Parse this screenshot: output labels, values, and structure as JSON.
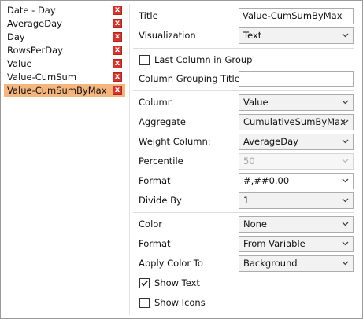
{
  "columns": [
    {
      "label": "Date - Day"
    },
    {
      "label": "AverageDay"
    },
    {
      "label": "Day"
    },
    {
      "label": "RowsPerDay"
    },
    {
      "label": "Value"
    },
    {
      "label": "Value-CumSum"
    },
    {
      "label": "Value-CumSumByMax",
      "selected": true
    }
  ],
  "delete_glyph": "x",
  "props": {
    "title_label": "Title",
    "title_value": "Value-CumSumByMax",
    "visualization_label": "Visualization",
    "visualization_value": "Text",
    "last_column_label": "Last Column in Group",
    "last_column_checked": false,
    "grouping_title_label": "Column Grouping Title",
    "grouping_title_value": "",
    "column_label": "Column",
    "column_value": "Value",
    "aggregate_label": "Aggregate",
    "aggregate_value": "CumulativeSumByMax",
    "weight_label": "Weight Column:",
    "weight_value": "AverageDay",
    "percentile_label": "Percentile",
    "percentile_value": "50",
    "format_label": "Format",
    "format_value": "#,##0.00",
    "divide_label": "Divide By",
    "divide_value": "1",
    "color_label": "Color",
    "color_value": "None",
    "color_format_label": "Format",
    "color_format_value": "From Variable",
    "apply_color_label": "Apply Color To",
    "apply_color_value": "Background",
    "show_text_label": "Show Text",
    "show_text_checked": true,
    "show_icons_label": "Show Icons",
    "show_icons_checked": false
  },
  "colors": {
    "selected_row": "#f4b67d",
    "delete_button": "#d8322a"
  }
}
